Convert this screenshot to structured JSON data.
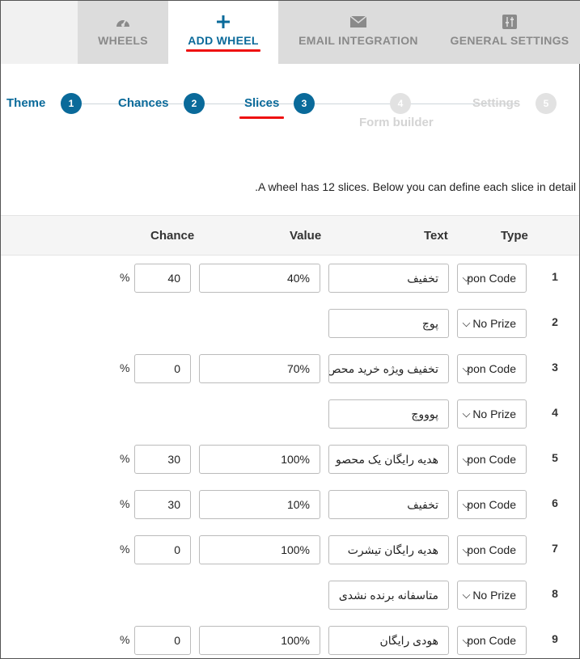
{
  "tabs": [
    {
      "label": "WHEELS",
      "icon": "gauge-icon"
    },
    {
      "label": "ADD WHEEL",
      "icon": "plus-icon"
    },
    {
      "label": "EMAIL INTEGRATION",
      "icon": "envelope-icon"
    },
    {
      "label": "GENERAL SETTINGS",
      "icon": "sliders-icon"
    }
  ],
  "active_tab": "ADD WHEEL",
  "colors": {
    "accent": "#0a6a9a",
    "underline": "#ee1111",
    "inactive_step": "#e2e2e2"
  },
  "stepper": {
    "steps": [
      {
        "label": "Theme",
        "number": "1"
      },
      {
        "label": "Chances",
        "number": "2"
      },
      {
        "label": "Slices",
        "number": "3"
      },
      {
        "label": "Form builder",
        "number": "4"
      },
      {
        "label": "Settings",
        "number": "5"
      }
    ],
    "current": 3
  },
  "info_text": ".A wheel has 12 slices. Below you can define each slice in detail",
  "table": {
    "headers": {
      "type": "Type",
      "text": "Text",
      "value": "Value",
      "chance": "Chance"
    },
    "percent_sign": "%",
    "rows": [
      {
        "num": "1",
        "type": "pon Code",
        "text": "تخفیف",
        "value": "40%",
        "chance": "40"
      },
      {
        "num": "2",
        "type": "No Prize",
        "text": "پوچ"
      },
      {
        "num": "3",
        "type": "pon Code",
        "text": "تخفیف ویژه خرید محص",
        "value": "70%",
        "chance": "0"
      },
      {
        "num": "4",
        "type": "No Prize",
        "text": "پوووچ"
      },
      {
        "num": "5",
        "type": "pon Code",
        "text": "هدیه رایگان یک محصو",
        "value": "100%",
        "chance": "30"
      },
      {
        "num": "6",
        "type": "pon Code",
        "text": "تخفیف",
        "value": "10%",
        "chance": "30"
      },
      {
        "num": "7",
        "type": "pon Code",
        "text": "هدیه رایگان تیشرت",
        "value": "100%",
        "chance": "0"
      },
      {
        "num": "8",
        "type": "No Prize",
        "text": "متاسفانه برنده نشدی"
      },
      {
        "num": "9",
        "type": "pon Code",
        "text": "هودی رایگان",
        "value": "100%",
        "chance": "0"
      }
    ]
  }
}
